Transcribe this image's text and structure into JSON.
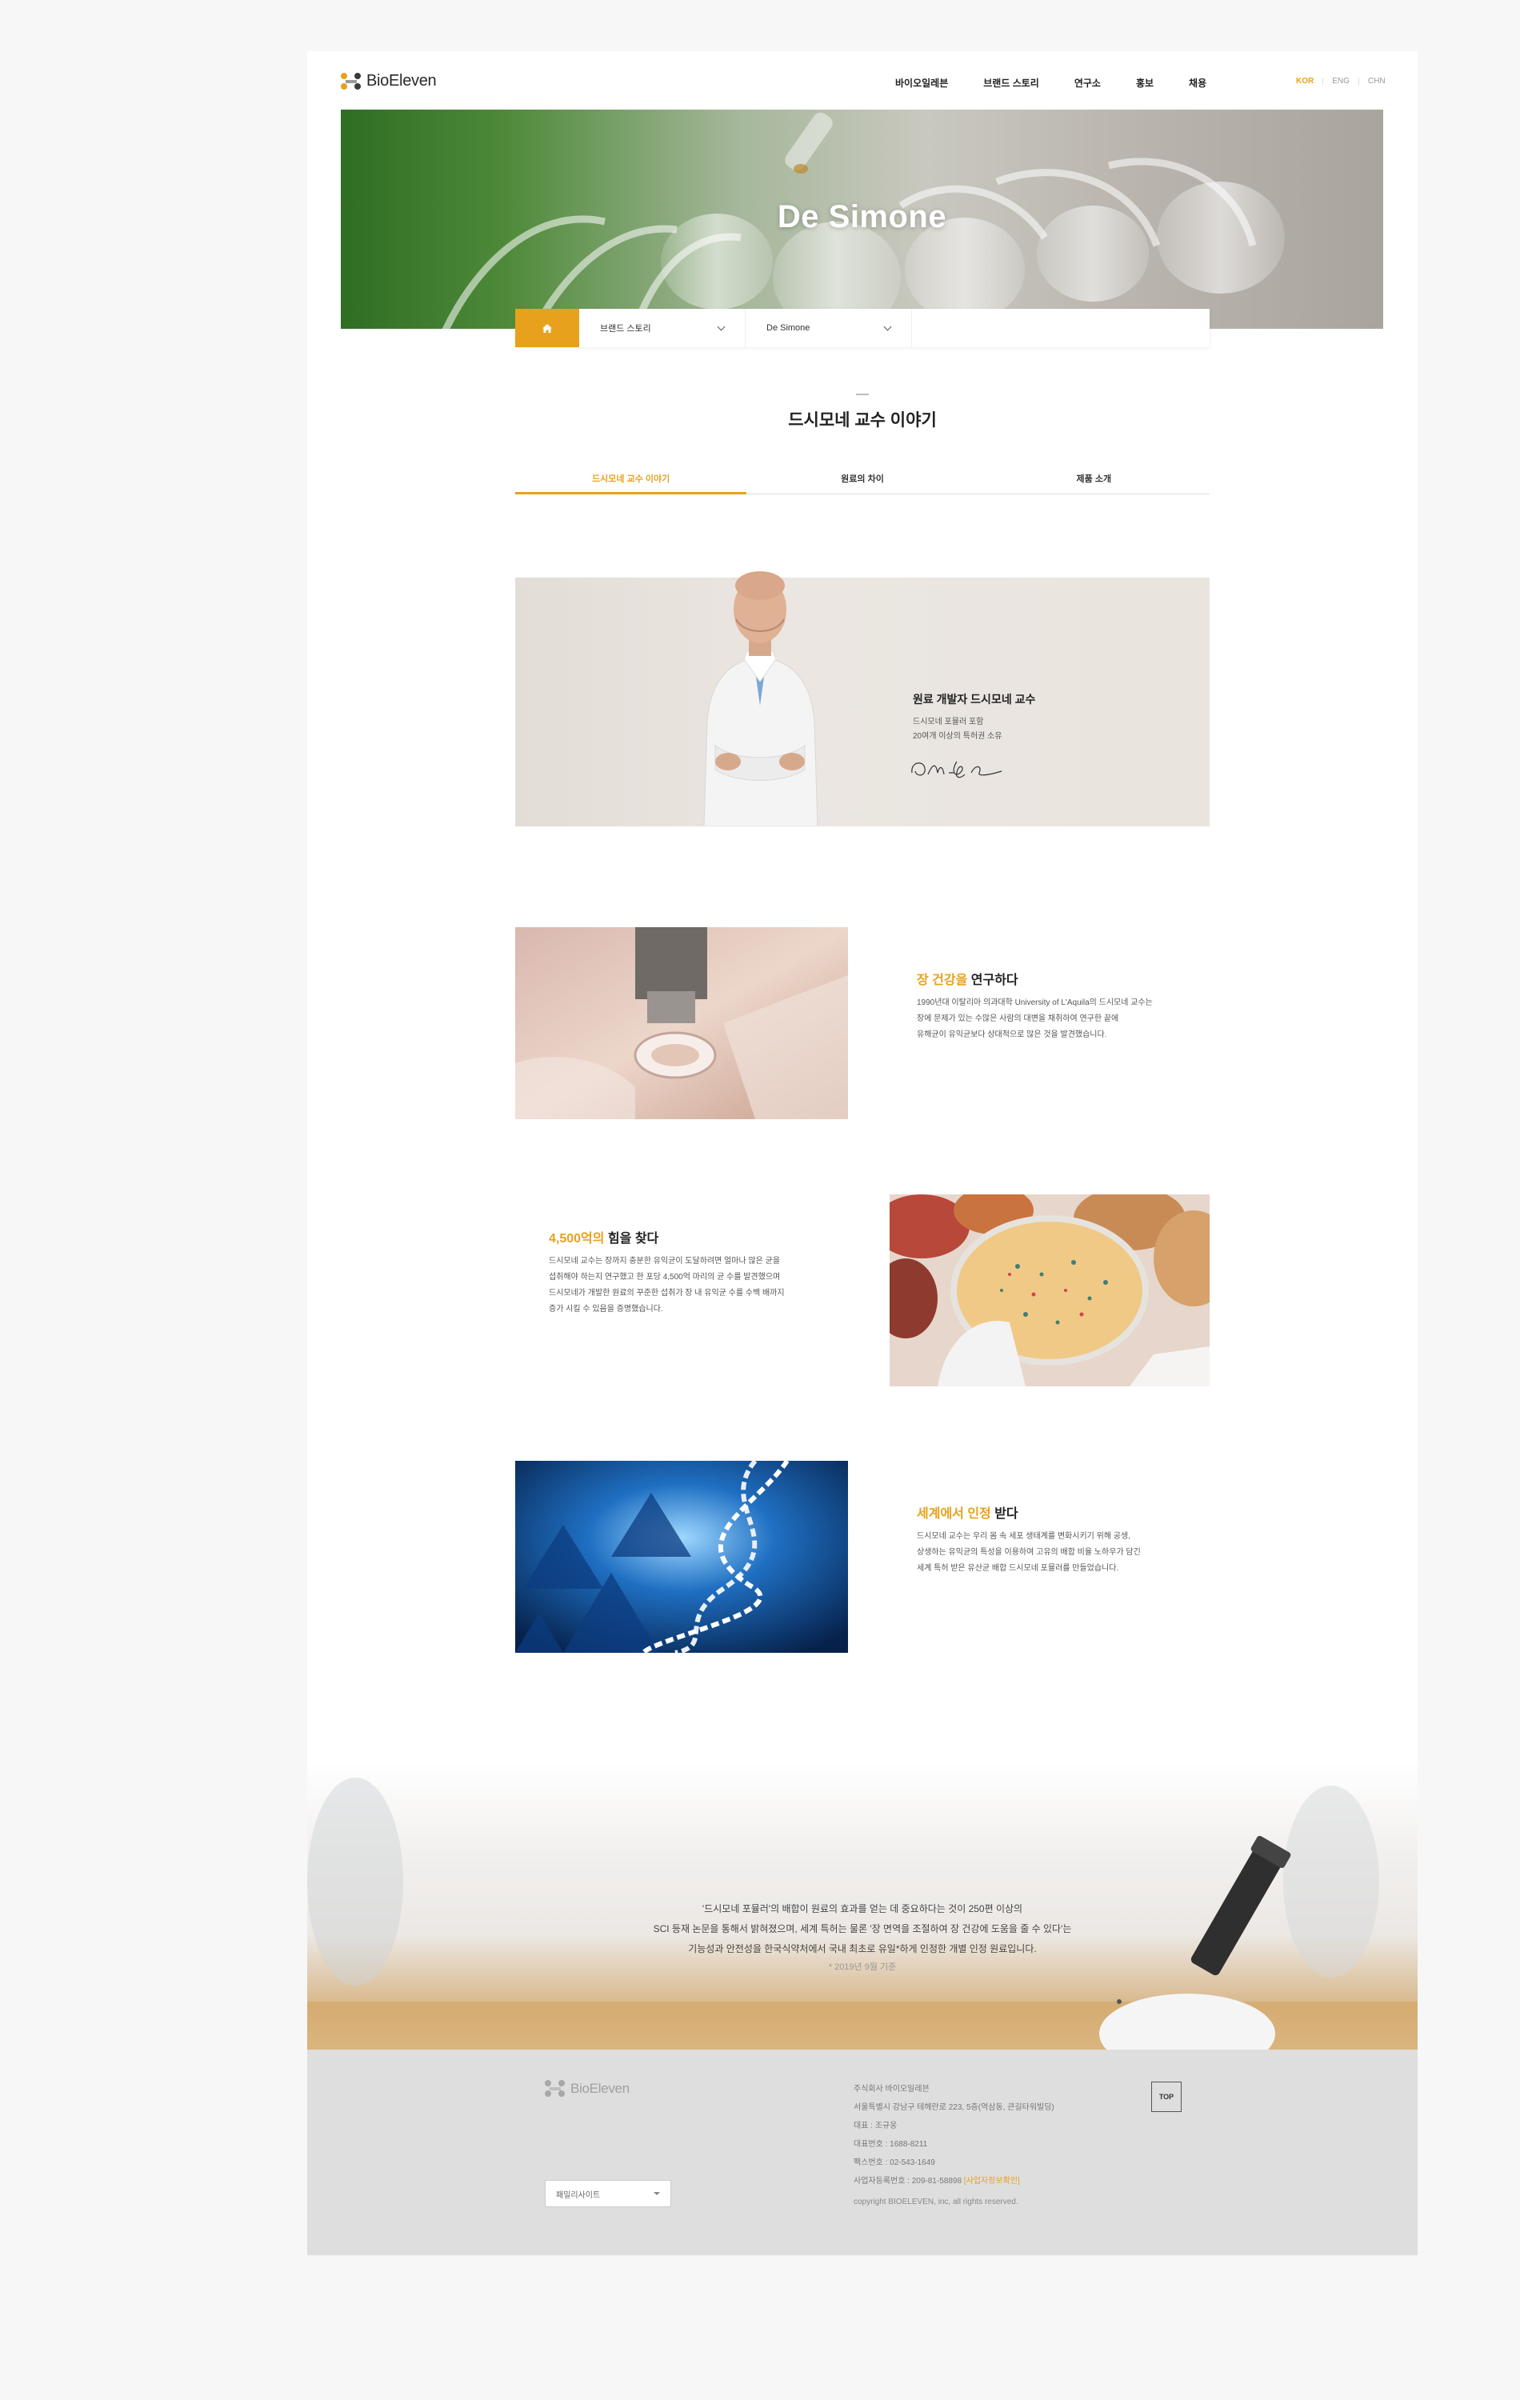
{
  "brand": {
    "name": "BioEleven"
  },
  "nav": [
    "바이오일레븐",
    "브랜드 스토리",
    "연구소",
    "홍보",
    "채용"
  ],
  "lang": [
    "KOR",
    "ENG",
    "CHN"
  ],
  "hero": {
    "title": "De Simone"
  },
  "location": {
    "menu1": "브랜드 스토리",
    "menu2": "De Simone"
  },
  "page": {
    "title": "드시모네 교수 이야기"
  },
  "tabs": [
    "드시모네 교수 이야기",
    "원료의 차이",
    "제품 소개"
  ],
  "professor": {
    "name": "원료 개발자 드시모네 교수",
    "desc1": "드시모네 포뮬러 포함",
    "desc2": "20여개 이상의 특허권 소유",
    "signature": "Claudio De Simone"
  },
  "sections": [
    {
      "highlight": "장 건강을",
      "rest": " 연구하다",
      "lines": [
        "1990년대 이탈리아 의과대학 University of L'Aquila의 드시모네 교수는",
        "장에 문제가 있는 수많은 사람의 대변을 채취하여 연구한 끝에",
        "유해균이 유익균보다 상대적으로 많은 것을 발견했습니다."
      ]
    },
    {
      "highlight": "4,500억의",
      "rest": " 힘을 찾다",
      "lines": [
        "드시모네 교수는 장까지 충분한 유익균이 도달하려면 얼마나 많은 균을",
        "섭취해야 하는지 연구했고 한 포당 4,500억 마리의 균 수를 발견했으며",
        "드시모네가 개발한 원료의 꾸준한 섭취가 장 내 유익균 수를 수백 배까지",
        "증가 시킬 수 있음을 증명했습니다."
      ]
    },
    {
      "highlight": "세계에서 인정",
      "rest": " 받다",
      "lines": [
        "드시모네 교수는 우리 몸 속 세포 생태계를 변화시키기 위해 공생,",
        "상생하는 유익균의 특성을 이용하여 고유의 배합 비율 노하우가 담긴",
        "세계 특허 받은 유산균 배합 드시모네 포뮬러를 만들었습니다."
      ]
    }
  ],
  "band": {
    "lines": [
      "'드시모네 포뮬러'의 배합이 원료의 효과를 얻는 데 중요하다는 것이 250편 이상의",
      "SCI 등재 논문을 통해서 밝혀졌으며, 세계 특허는 물론 '장 면역을 조절하여 장 건강에 도움을 줄 수 있다'는",
      "기능성과 안전성을 한국식약처에서 국내 최초로 유일*하게 인정한 개별 인정 원료입니다."
    ],
    "note": "* 2019년 9월 기준"
  },
  "footer": {
    "company": "주식회사 바이오일레븐",
    "address": "서울특별시 강남구 테헤란로 223, 5층(역삼동, 큰길타워빌딩)",
    "ceo": "대표 : 조규웅",
    "tel": "대표번호 : 1688-8211",
    "fax": "팩스번호 : 02-543-1649",
    "bizno": "사업자등록번호 : 209-81-58898",
    "biz_link": "[사업자정보확인]",
    "copyright": "copyright BIOELEVEN, inc, all rights reserved.",
    "family_label": "패밀리사이트",
    "top_label": "TOP"
  },
  "colors": {
    "accent": "#e8a11c",
    "footer_bg": "#dedede"
  },
  "icons": [
    "home-icon",
    "chevron-down-icon",
    "logo-icon"
  ]
}
